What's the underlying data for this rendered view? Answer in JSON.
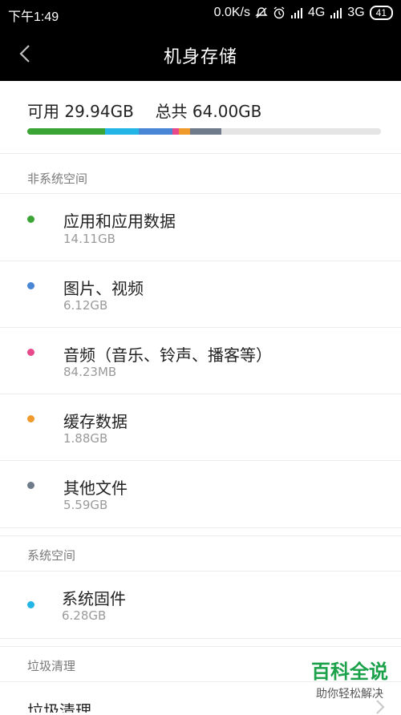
{
  "status_bar": {
    "time": "下午1:49",
    "network_speed": "0.0K/s",
    "signal_4g": "4G",
    "signal_3g": "3G",
    "battery": "41"
  },
  "header": {
    "title": "机身存储"
  },
  "summary": {
    "available_label": "可用",
    "available_value": "29.94GB",
    "total_label": "总共",
    "total_value": "64.00GB"
  },
  "usage_colors": {
    "apps": "#3aa535",
    "system": "#22b5e6",
    "images": "#4a86d6",
    "audio": "#e7498b",
    "cache": "#f09a2c",
    "other": "#6f7a8a"
  },
  "sections": {
    "non_system": {
      "header": "非系统空间",
      "items": [
        {
          "title": "应用和应用数据",
          "size": "14.11GB",
          "color": "#3aa535"
        },
        {
          "title": "图片、视频",
          "size": "6.12GB",
          "color": "#4a86d6"
        },
        {
          "title": "音频（音乐、铃声、播客等）",
          "size": "84.23MB",
          "color": "#e7498b"
        },
        {
          "title": "缓存数据",
          "size": "1.88GB",
          "color": "#f09a2c"
        },
        {
          "title": "其他文件",
          "size": "5.59GB",
          "color": "#6f7a8a"
        }
      ]
    },
    "system": {
      "header": "系统空间",
      "items": [
        {
          "title": "系统固件",
          "size": "6.28GB",
          "color": "#22b5e6"
        }
      ]
    },
    "junk": {
      "header": "垃圾清理",
      "items": [
        {
          "title": "垃圾清理"
        }
      ]
    }
  },
  "watermark": {
    "title": "百科全说",
    "subtitle": "助你轻松解决"
  }
}
